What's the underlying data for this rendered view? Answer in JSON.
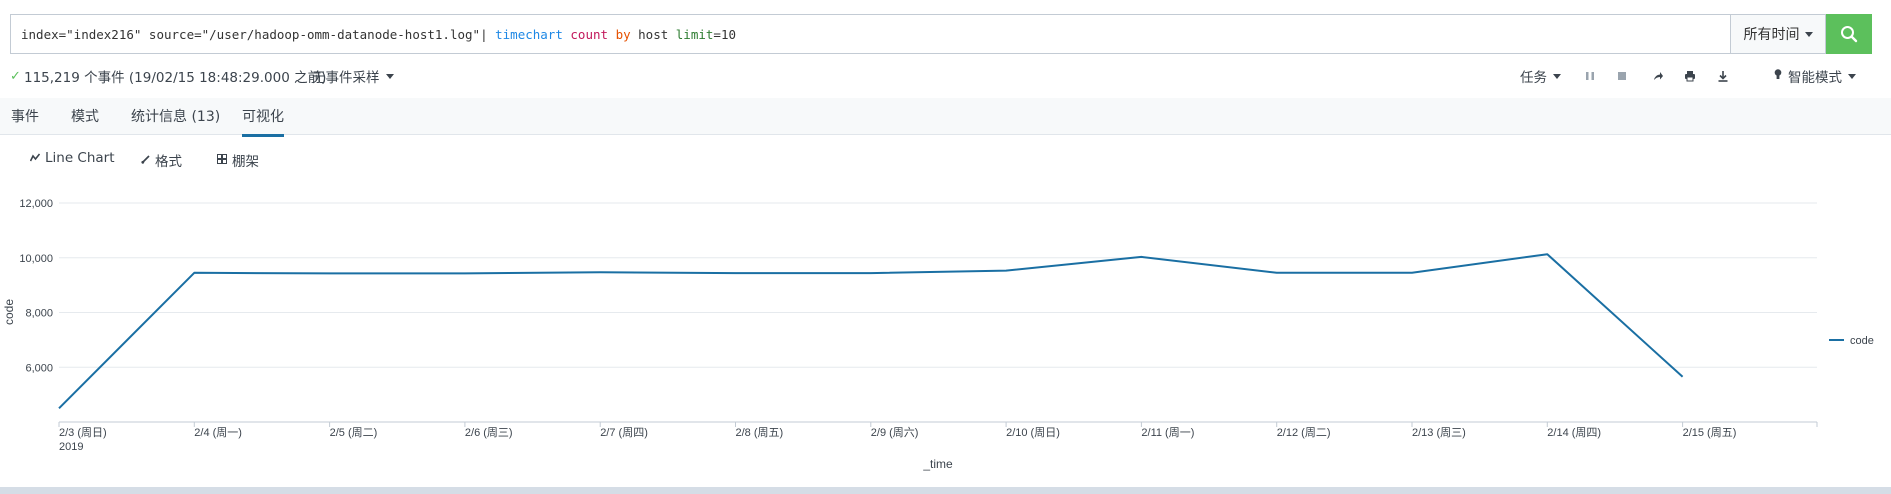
{
  "search": {
    "query_parts": [
      {
        "cls": "q-plain",
        "text": "index=\"index216\" source=\"/user/hadoop-omm-datanode-host1.log\"| "
      },
      {
        "cls": "q-cmd",
        "text": "timechart"
      },
      {
        "cls": "q-plain",
        "text": " "
      },
      {
        "cls": "q-fn",
        "text": "count"
      },
      {
        "cls": "q-plain",
        "text": " "
      },
      {
        "cls": "q-kw",
        "text": "by"
      },
      {
        "cls": "q-plain",
        "text": " host "
      },
      {
        "cls": "q-arg",
        "text": "limit"
      },
      {
        "cls": "q-plain",
        "text": "=10"
      }
    ],
    "time_range": "所有时间",
    "search_icon": "search-icon",
    "button_color": "#5cc05c"
  },
  "status": {
    "event_count": "115,219 个事件 (19/02/15 18:48:29.000 之前)",
    "sampling": "无事件采样",
    "job_menu": "任务",
    "mode": "智能模式"
  },
  "tabs": [
    {
      "label": "事件",
      "active": false
    },
    {
      "label": "模式",
      "active": false
    },
    {
      "label": "统计信息 (13)",
      "active": false
    },
    {
      "label": "可视化",
      "active": true
    }
  ],
  "viz_toolbar": {
    "chart_type": "Line Chart",
    "format": "格式",
    "trellis": "棚架"
  },
  "chart_data": {
    "type": "line",
    "xlabel": "_time",
    "ylabel": "code",
    "x_labels": [
      "2/3 (周日)",
      "2/4 (周一)",
      "2/5 (周二)",
      "2/6 (周三)",
      "2/7 (周四)",
      "2/8 (周五)",
      "2/9 (周六)",
      "2/10 (周日)",
      "2/11 (周一)",
      "2/12 (周二)",
      "2/13 (周三)",
      "2/14 (周四)",
      "2/15 (周五)"
    ],
    "year_label": "2019",
    "y_ticks": [
      6000,
      8000,
      10000,
      12000
    ],
    "y_tick_labels": [
      "6,000",
      "8,000",
      "10,000",
      "12,000"
    ],
    "ylim": [
      4000,
      12000
    ],
    "series": [
      {
        "name": "code",
        "color": "#1a6fa3",
        "values": [
          4500,
          9450,
          9430,
          9430,
          9470,
          9440,
          9440,
          9530,
          10030,
          9450,
          9450,
          10130,
          5650
        ]
      }
    ],
    "legend_position": "right",
    "grid": true
  }
}
